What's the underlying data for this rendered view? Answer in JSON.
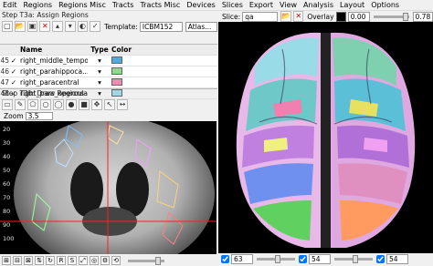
{
  "menu": [
    "Edit",
    "Regions",
    "Regions Misc",
    "Tracts",
    "Tracts Misc",
    "Devices",
    "Slices",
    "Export",
    "View",
    "Analysis",
    "Layout",
    "Options"
  ],
  "step3a": {
    "title": "Step T3a: Assign Regions",
    "template_label": "Template:",
    "template_value": "ICBM152",
    "atlas_label": "Atlas..."
  },
  "region_table": {
    "headers": [
      "Name",
      "Type",
      "Color"
    ],
    "rows": [
      {
        "id": "45",
        "name": "right_middle_tempo...",
        "type": "",
        "color": "#4fa8e0"
      },
      {
        "id": "46",
        "name": "right_parahippoca...",
        "type": "",
        "color": "#8ed88a"
      },
      {
        "id": "47",
        "name": "right_paracentral",
        "type": "",
        "color": "#f08ab0"
      },
      {
        "id": "48",
        "name": "right_pars_opercula",
        "type": "",
        "color": "#a0d8e8"
      }
    ]
  },
  "step3b": {
    "title": "Step T3b: Draw Regions",
    "zoom_label": "Zoom",
    "zoom_value": "3.5",
    "ruler": [
      "20",
      "30",
      "40",
      "50",
      "60",
      "70",
      "80",
      "90",
      "100"
    ]
  },
  "slice_toolbar": {
    "slice_label": "Slice:",
    "slice_value": "qa",
    "overlay_label": "Overlay",
    "overlay_value": "0.00",
    "opacity_value": "0.78"
  },
  "bottom_right": {
    "x": "63",
    "y": "54",
    "z": "54"
  },
  "colors": {
    "crosshair": "#ff2020",
    "brain_bg": "#000000"
  }
}
